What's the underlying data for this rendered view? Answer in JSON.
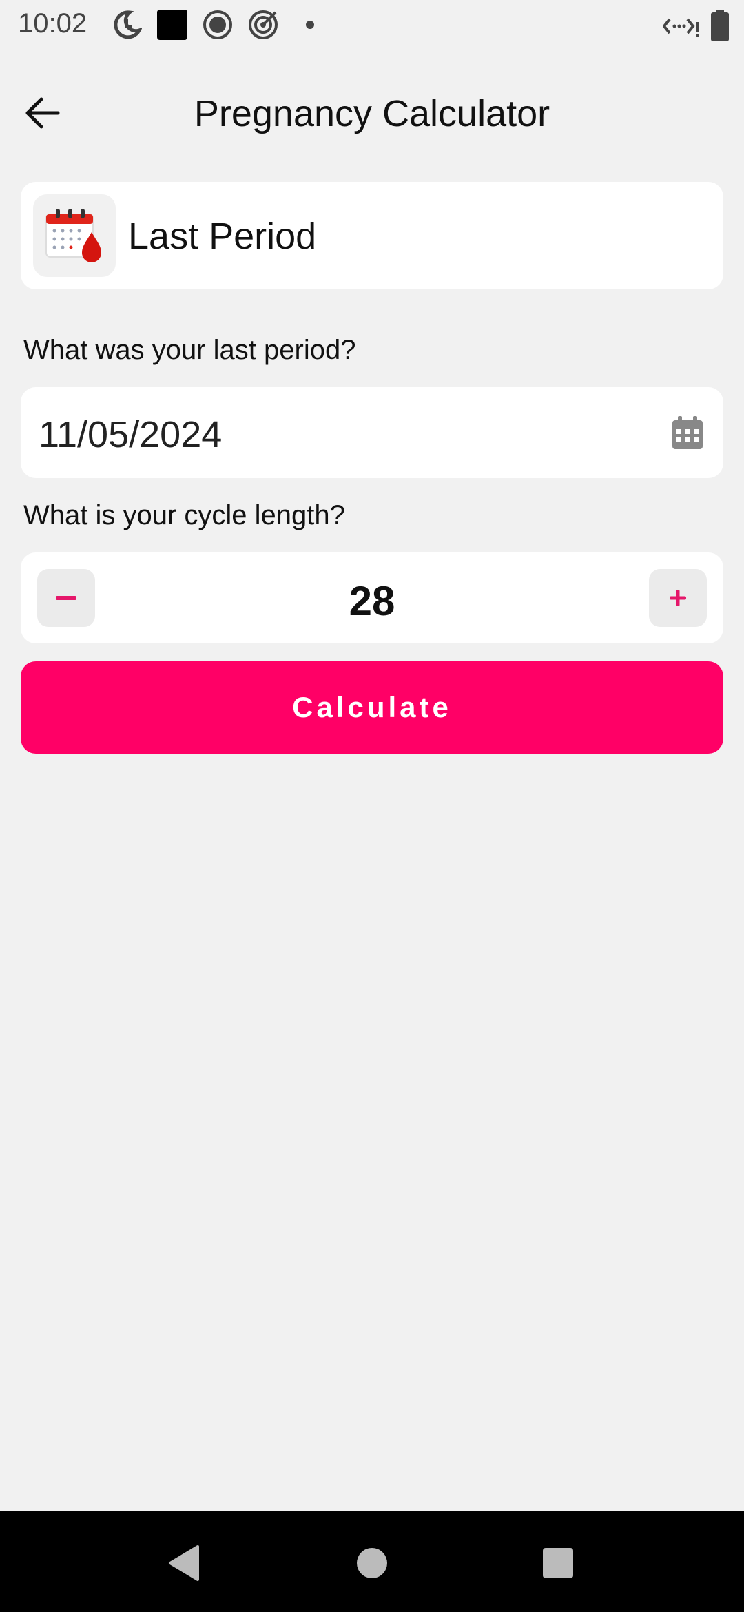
{
  "status_bar": {
    "time": "10:02",
    "icons": [
      "do-not-disturb-icon",
      "black-square-icon",
      "record-icon",
      "target-icon",
      "dot-icon",
      "data-arrows-icon",
      "battery-icon"
    ]
  },
  "app_bar": {
    "title": "Pregnancy Calculator",
    "back_icon": "arrow-left-icon"
  },
  "header_card": {
    "icon": "calendar-blood-drop-icon",
    "label": "Last Period"
  },
  "last_period": {
    "question": "What was your last period?",
    "value": "11/05/2024",
    "icon": "calendar-icon"
  },
  "cycle_length": {
    "question": "What is your cycle length?",
    "value": "28",
    "minus_label": "−",
    "plus_label": "+"
  },
  "actions": {
    "calculate_label": "Calculate"
  },
  "colors": {
    "accent": "#ff0066",
    "stepper_icon": "#e5176a",
    "background": "#f1f1f1",
    "card": "#ffffff"
  },
  "nav_bar": {
    "icons": [
      "back-triangle-icon",
      "home-circle-icon",
      "recents-square-icon"
    ]
  }
}
